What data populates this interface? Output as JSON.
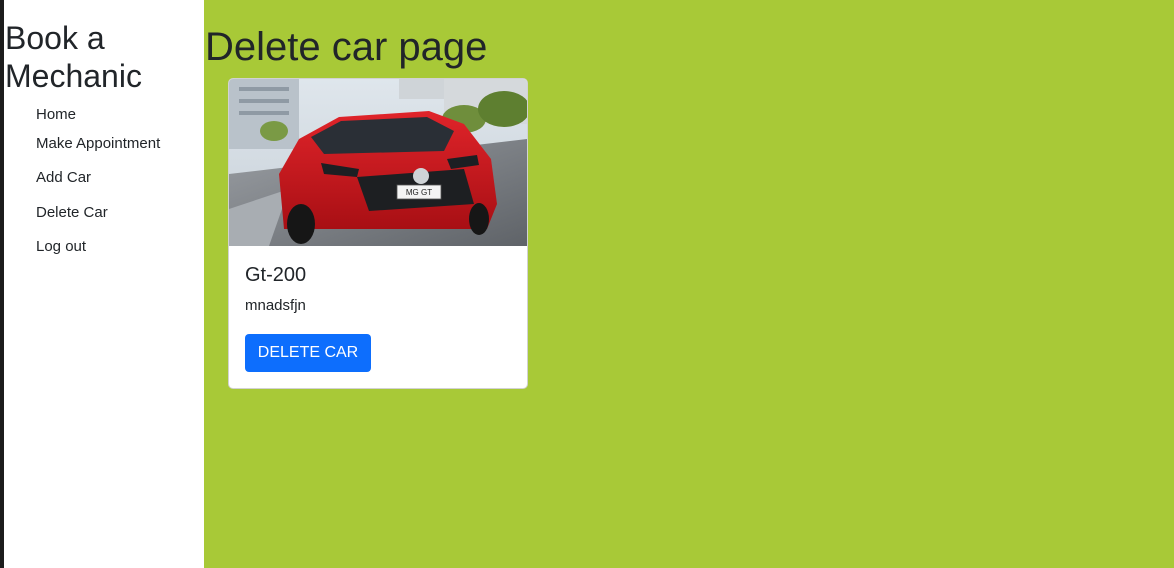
{
  "sidebar": {
    "brand": "Book a Mechanic",
    "nav": [
      {
        "label": "Home"
      },
      {
        "label": "Make Appointment"
      },
      {
        "label": "Add Car"
      },
      {
        "label": "Delete Car"
      },
      {
        "label": "Log out"
      }
    ]
  },
  "main": {
    "title": "Delete car page",
    "cards": [
      {
        "name": "Gt-200",
        "description": "mnadsfjn",
        "button_label": "DELETE CAR",
        "image_badge": "MG GT"
      }
    ]
  },
  "colors": {
    "main_background": "#a8c937",
    "button": "#0d6efd",
    "car_body": "#c8141a"
  }
}
